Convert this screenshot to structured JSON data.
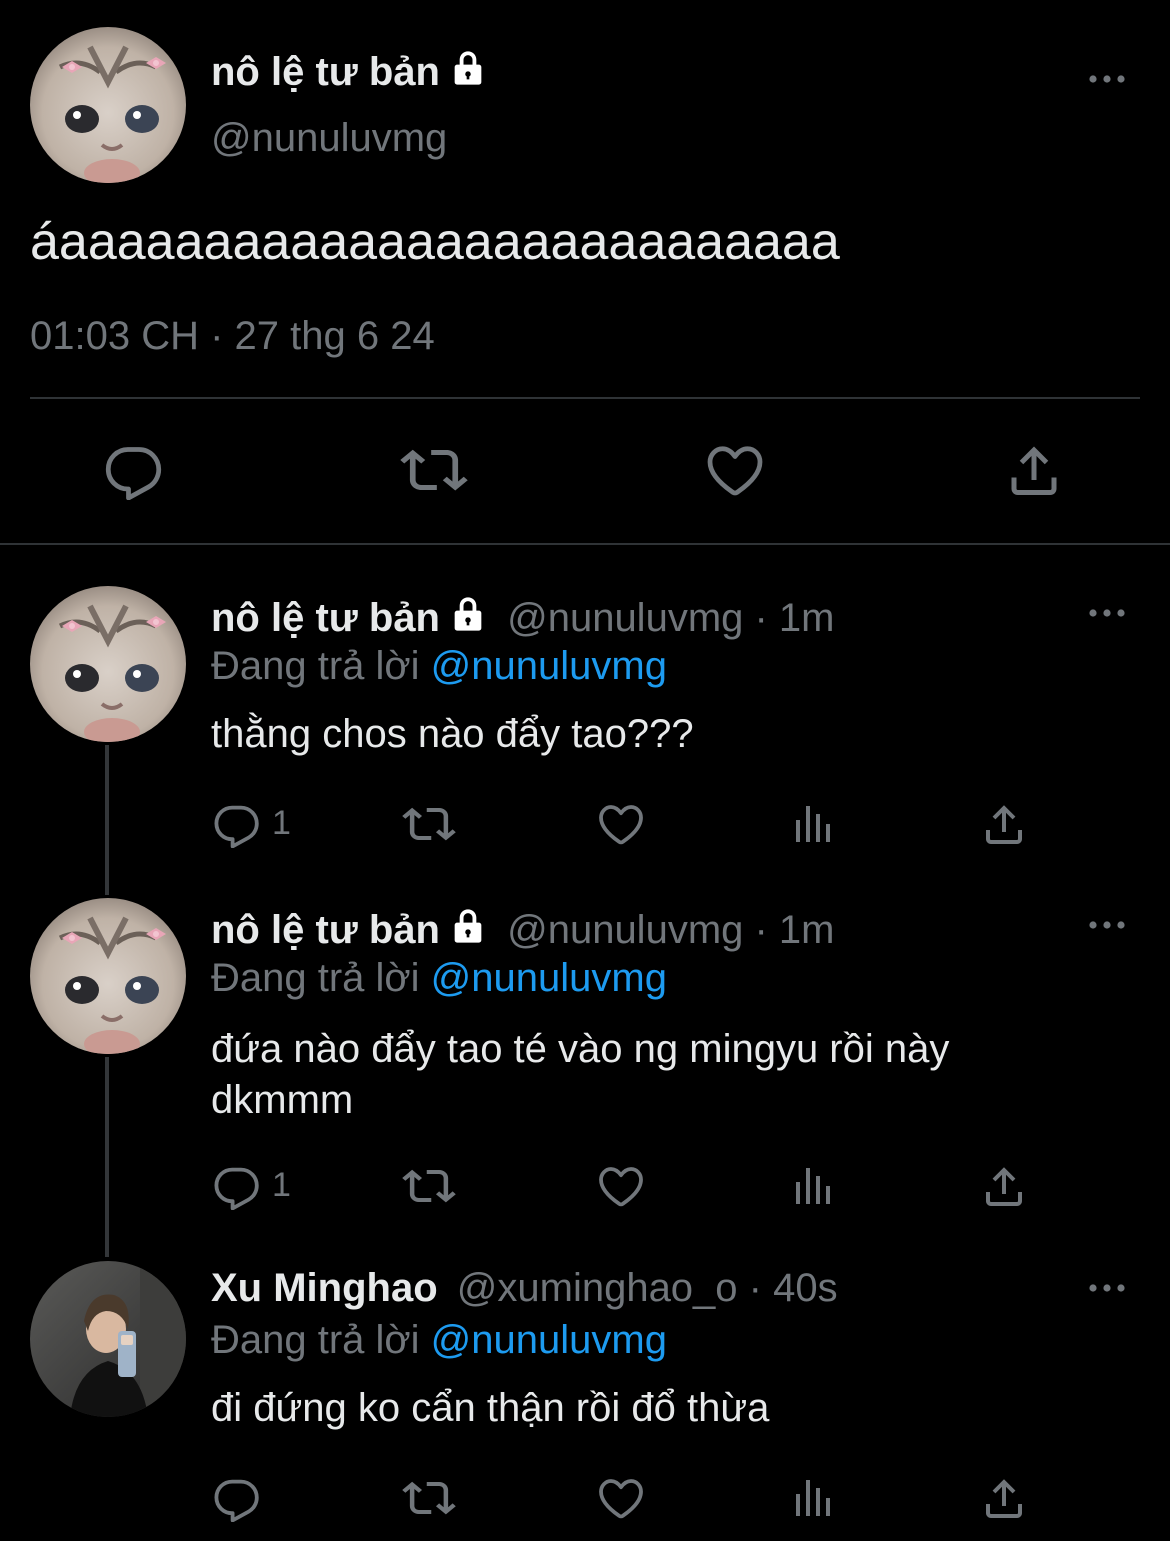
{
  "main_tweet": {
    "display_name": "nô lệ tư bản",
    "handle": "@nunuluvmg",
    "text": "áaaaaaaaaaaaaaaaaaaaaaaaaaaa",
    "timestamp": "01:03 CH · 27 thg 6 24"
  },
  "replies": [
    {
      "display_name": "nô lệ tư bản",
      "handle_time": "@nunuluvmg · 1m",
      "replying_label": "Đang trả lời",
      "replying_to": "@nunuluvmg",
      "text": "thằng chos nào đẩy tao???",
      "reply_count": "1"
    },
    {
      "display_name": "nô lệ tư bản",
      "handle_time": "@nunuluvmg · 1m",
      "replying_label": "Đang trả lời",
      "replying_to": "@nunuluvmg",
      "text": "đứa nào đẩy tao té vào ng mingyu rồi này dkmmm",
      "reply_count": "1"
    },
    {
      "display_name": "Xu Minghao",
      "handle_time": "@xuminghao_o · 40s",
      "replying_label": "Đang trả lời",
      "replying_to": "@nunuluvmg",
      "text": "đi đứng ko cẩn thận rồi đổ thừa",
      "reply_count": ""
    }
  ],
  "icons": {
    "reply": "reply-icon",
    "retweet": "retweet-icon",
    "like": "heart-icon",
    "views": "views-icon",
    "share": "share-icon",
    "more": "more-icon",
    "lock": "lock-icon"
  },
  "colors": {
    "background": "#000000",
    "text": "#e7e9ea",
    "muted": "#71767b",
    "link": "#1d9bf0"
  }
}
